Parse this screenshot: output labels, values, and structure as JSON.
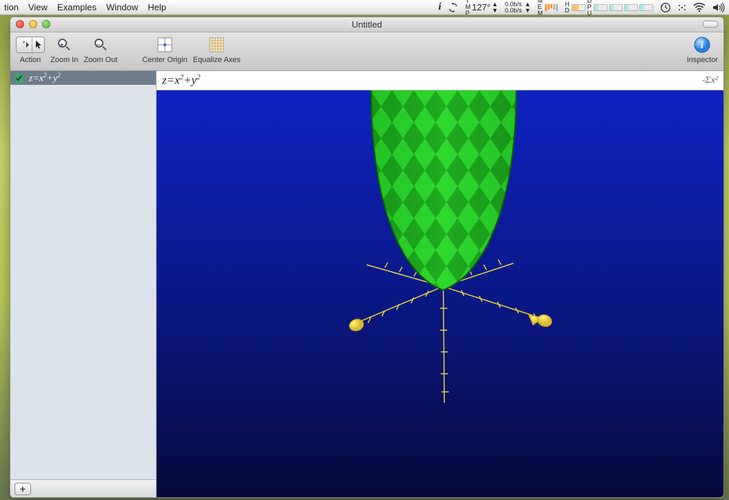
{
  "menubar": {
    "items": [
      "tion",
      "View",
      "Examples",
      "Window",
      "Help"
    ],
    "status": {
      "temperature": "127°",
      "net_up": "0.0b/s",
      "net_down": "0.0b/s"
    }
  },
  "window": {
    "title": "Untitled"
  },
  "toolbar": {
    "action": "Action",
    "zoom_in": "Zoom In",
    "zoom_out": "Zoom Out",
    "center_origin": "Center Origin",
    "equalize_axes": "Equalize Axes",
    "inspector": "Inspector"
  },
  "sidebar": {
    "equations": [
      {
        "checked": true,
        "display": "z=x²+y²"
      }
    ],
    "add_label": "+"
  },
  "expression_bar": {
    "current": "z=x²+y²",
    "sigma_label": "-Σx²"
  },
  "plot": {
    "function": "z = x^2 + y^2",
    "type": "3d-surface",
    "surface_color": "#27c627",
    "surface_color_dark": "#178a17",
    "background_top": "#0d1fb3",
    "background_bottom": "#070a33",
    "axis_color": "#e8d83a",
    "axis_ticks_per_side": 5
  }
}
